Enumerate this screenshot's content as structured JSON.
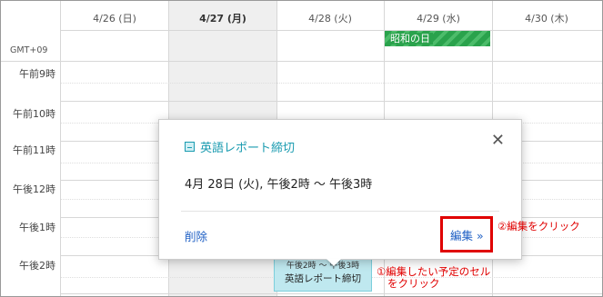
{
  "calendar": {
    "timezone": "GMT+09",
    "days": [
      {
        "label": "4/26 (日)"
      },
      {
        "label": "4/27 (月)"
      },
      {
        "label": "4/28 (火)"
      },
      {
        "label": "4/29 (水)"
      },
      {
        "label": "4/30 (木)"
      }
    ],
    "time_slots": [
      "午前9時",
      "午前10時",
      "午前11時",
      "午後12時",
      "午後1時",
      "午後2時"
    ],
    "allday_event": "昭和の日",
    "event": {
      "time": "午後2時 ～ 午後3時",
      "title": "英語レポート締切"
    }
  },
  "popup": {
    "title": "英語レポート締切",
    "datetime": "4月 28日 (火), 午後2時 ～ 午後3時",
    "close_label": "✕",
    "delete_label": "削除",
    "edit_label": "編集 »"
  },
  "annotations": {
    "step1_line1": "①編集したい予定のセル",
    "step1_line2": "をクリック",
    "step2": "②編集をクリック",
    "color": "#e00000"
  }
}
